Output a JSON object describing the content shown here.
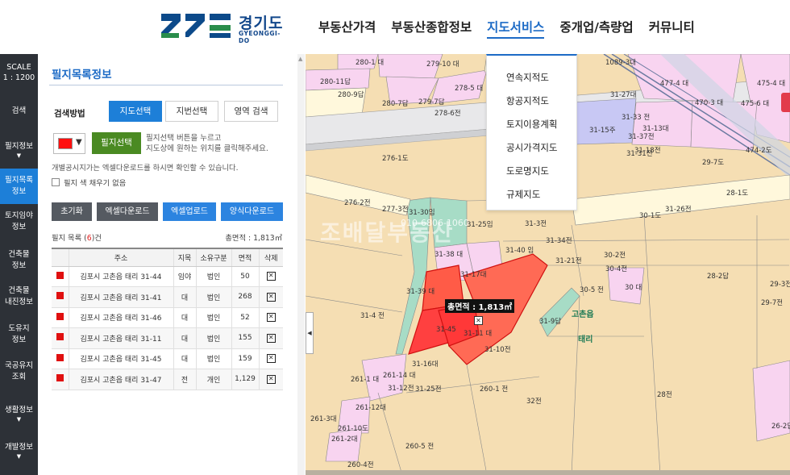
{
  "header": {
    "logo_name": "경기도",
    "logo_sub": "GYEONGGI-DO",
    "nav": [
      "부동산가격",
      "부동산종합정보",
      "지도서비스",
      "중개업/측량업",
      "커뮤니티"
    ],
    "active_nav": "지도서비스",
    "accent_color": "#1d6bc6"
  },
  "dropdown": {
    "items": [
      "연속지적도",
      "항공지적도",
      "토지이용계획",
      "공시가격지도",
      "도로명지도",
      "규제지도"
    ]
  },
  "rail": {
    "scale_label": "SCALE",
    "scale_value": "1 : 1200",
    "items": [
      {
        "label": "검색"
      },
      {
        "label": "필지정보"
      },
      {
        "label": "필지목록\n정보"
      },
      {
        "label": "토지임야\n정보"
      },
      {
        "label": "건축물\n정보"
      },
      {
        "label": "건축물\n내진정보"
      },
      {
        "label": "도유지\n정보"
      },
      {
        "label": "국공유지\n조회"
      },
      {
        "label": "생활정보"
      },
      {
        "label": "개발정보"
      }
    ]
  },
  "panel": {
    "title": "필지목록정보",
    "method_label": "검색방법",
    "method_tabs": [
      "지도선택",
      "지번선택",
      "영역 검색"
    ],
    "active_method": "지도선택",
    "select_button": "필지선택",
    "hint": "필지선택 버튼을 누르고\n지도상에 원하는 위치를 클릭해주세요.",
    "note": "개별공시지가는 엑셀다운로드를 하시면 확인할 수 있습니다.",
    "fill_checkbox_label": "필지 색 채우기 없음",
    "fill_color": "#ff1010",
    "actions": [
      "초기화",
      "엑셀다운로드",
      "엑셀업로드",
      "양식다운로드"
    ],
    "list_label_prefix": "필지 목록 (",
    "list_count": "6",
    "list_label_suffix": ")건",
    "total_area": "총면적 : 1,813㎡",
    "table": {
      "headers": [
        "",
        "주소",
        "지목",
        "소유구분",
        "면적",
        "삭제"
      ],
      "rows": [
        {
          "addr": "김포시 고촌읍 태리 31-44",
          "jimok": "임야",
          "owner": "법인",
          "area": "50"
        },
        {
          "addr": "김포시 고촌읍 태리 31-41",
          "jimok": "대",
          "owner": "법인",
          "area": "268"
        },
        {
          "addr": "김포시 고촌읍 태리 31-46",
          "jimok": "대",
          "owner": "법인",
          "area": "52"
        },
        {
          "addr": "김포시 고촌읍 태리 31-11",
          "jimok": "대",
          "owner": "법인",
          "area": "155"
        },
        {
          "addr": "김포시 고촌읍 태리 31-45",
          "jimok": "대",
          "owner": "법인",
          "area": "159"
        },
        {
          "addr": "김포시 고촌읍 태리 31-47",
          "jimok": "전",
          "owner": "개인",
          "area": "1,129"
        }
      ]
    }
  },
  "map": {
    "total_area_label": "총면적 : 1,813㎡",
    "town_name": "고촌읍",
    "village_name": "태리",
    "watermark": "조배달부동산",
    "watermark_phone": "010-6806-1060",
    "parcel_labels": [
      "280-1 대",
      "279-10 대",
      "280-11답",
      "278-5 대",
      "280-9답",
      "280-7답",
      "279-7답",
      "278-6전",
      "276-1도",
      "276-2전",
      "277-3전",
      "31-30임",
      "31-25임",
      "31-38 대",
      "31-40 임",
      "31-17대",
      "31-3전",
      "31-34전",
      "31-21전",
      "31-39 대",
      "31-4 전",
      "31-45",
      "31-11 대",
      "31-9답",
      "31-10전",
      "30-2전",
      "30-4전",
      "30-5 전",
      "30 대",
      "30-1도",
      "28-2답",
      "28-1도",
      "29-3전",
      "29-7전",
      "31-16대",
      "261-1 대",
      "261-14 대",
      "31-12전",
      "31-25전",
      "260-1 전",
      "32전",
      "28전",
      "261-12대",
      "261-3대",
      "261-10도",
      "261-2대",
      "260-5 전",
      "260-4전",
      "26-2답",
      "31-15주",
      "31-27대",
      "31-37전",
      "31-13대",
      "31-18전",
      "31-31전",
      "475-4 대",
      "474-2도",
      "29-7도",
      "477-4 대",
      "470-3 대",
      "475-6 대",
      "1089-3대",
      "31-33 전",
      "31-26전"
    ]
  }
}
